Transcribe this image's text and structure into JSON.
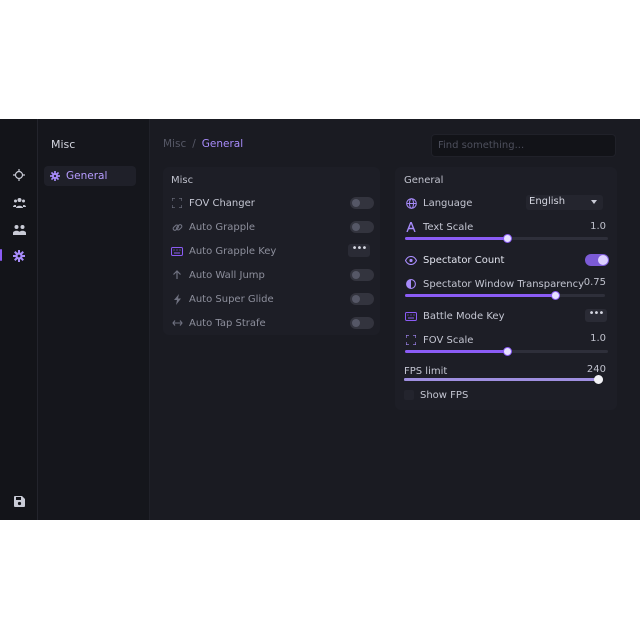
{
  "rail": {
    "icons": [
      "crosshair-icon",
      "users-icon",
      "group-icon",
      "gear-icon",
      "save-icon"
    ]
  },
  "nav": {
    "title": "Misc",
    "items": [
      {
        "label": "General",
        "icon": "gear-icon"
      }
    ]
  },
  "breadcrumb": {
    "parent": "Misc",
    "separator": "/",
    "current": "General"
  },
  "search": {
    "placeholder": "Find something...",
    "value": ""
  },
  "misc": {
    "title": "Misc",
    "rows": [
      {
        "label": "FOV Changer",
        "icon": "focus-frame-icon",
        "control": "toggle",
        "on": false
      },
      {
        "label": "Auto Grapple",
        "icon": "link-icon",
        "control": "toggle",
        "on": false
      },
      {
        "label": "Auto Grapple Key",
        "icon": "keyboard-icon",
        "control": "more",
        "more_label": "•••"
      },
      {
        "label": "Auto Wall Jump",
        "icon": "arrow-up-icon",
        "control": "toggle",
        "on": false
      },
      {
        "label": "Auto Super Glide",
        "icon": "lightning-icon",
        "control": "toggle",
        "on": false
      },
      {
        "label": "Auto Tap Strafe",
        "icon": "arrows-horizontal-icon",
        "control": "toggle",
        "on": false
      }
    ]
  },
  "general": {
    "title": "General",
    "language": {
      "label": "Language",
      "icon": "globe-icon",
      "value": "English"
    },
    "text_scale": {
      "label": "Text Scale",
      "icon": "text-icon",
      "value": "1.0",
      "level": 0.5
    },
    "spectator_count": {
      "label": "Spectator Count",
      "icon": "eye-icon",
      "on": true
    },
    "spectator_transparency": {
      "label": "Spectator Window Transparency",
      "icon": "contrast-icon",
      "value": "0.75",
      "level": 0.75
    },
    "battle_mode_key": {
      "label": "Battle Mode Key",
      "icon": "keyboard-icon",
      "more_label": "•••"
    },
    "fov_scale": {
      "label": "FOV Scale",
      "icon": "focus-frame-icon",
      "value": "1.0",
      "level": 0.5
    },
    "fps_limit": {
      "label": "FPS limit",
      "value": "240",
      "level": 1.0
    },
    "show_fps": {
      "label": "Show FPS",
      "checked": false
    }
  },
  "colors": {
    "accent": "#8b5cf6",
    "background": "#17181f",
    "panel": "#1d1e26"
  }
}
